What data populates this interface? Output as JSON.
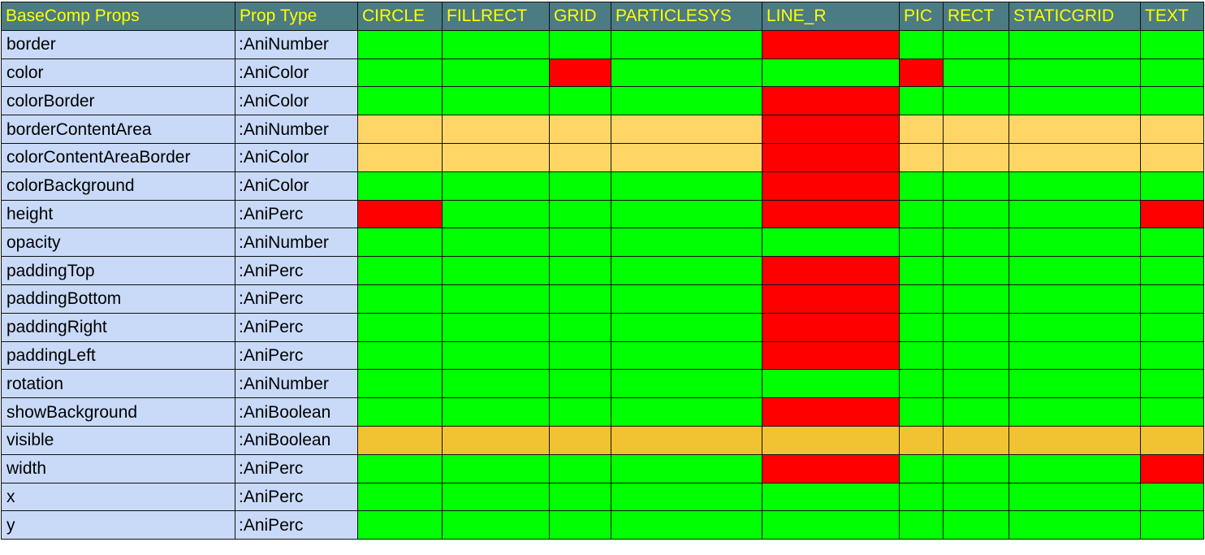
{
  "colors": {
    "header_bg": "#4b7b83",
    "header_text": "#ffff00",
    "prop_bg": "#c9daf8",
    "ok": "#00ff00",
    "fail": "#ff0000",
    "partial_light": "#ffd666",
    "partial_dark": "#f1c232"
  },
  "legend": {
    "G": "green",
    "R": "red",
    "P": "pale",
    "A": "amber"
  },
  "headers": [
    "BaseComp Props",
    "Prop Type",
    "CIRCLE",
    "FILLRECT",
    "GRID",
    "PARTICLESYS",
    "LINE_R",
    "PIC",
    "RECT",
    "STATICGRID",
    "TEXT"
  ],
  "rows": [
    {
      "prop": "border",
      "type": ":AniNumber",
      "status": [
        "G",
        "G",
        "G",
        "G",
        "R",
        "G",
        "G",
        "G",
        "G"
      ]
    },
    {
      "prop": "color",
      "type": ":AniColor",
      "status": [
        "G",
        "G",
        "R",
        "G",
        "G",
        "R",
        "G",
        "G",
        "G"
      ]
    },
    {
      "prop": "colorBorder",
      "type": ":AniColor",
      "status": [
        "G",
        "G",
        "G",
        "G",
        "R",
        "G",
        "G",
        "G",
        "G"
      ]
    },
    {
      "prop": "borderContentArea",
      "type": ":AniNumber",
      "status": [
        "P",
        "P",
        "P",
        "P",
        "R",
        "P",
        "P",
        "P",
        "P"
      ]
    },
    {
      "prop": "colorContentAreaBorder",
      "type": ":AniColor",
      "status": [
        "P",
        "P",
        "P",
        "P",
        "R",
        "P",
        "P",
        "P",
        "P"
      ]
    },
    {
      "prop": "colorBackground",
      "type": ":AniColor",
      "status": [
        "G",
        "G",
        "G",
        "G",
        "R",
        "G",
        "G",
        "G",
        "G"
      ]
    },
    {
      "prop": "height",
      "type": ":AniPerc",
      "status": [
        "R",
        "G",
        "G",
        "G",
        "R",
        "G",
        "G",
        "G",
        "R"
      ]
    },
    {
      "prop": "opacity",
      "type": ":AniNumber",
      "status": [
        "G",
        "G",
        "G",
        "G",
        "G",
        "G",
        "G",
        "G",
        "G"
      ]
    },
    {
      "prop": "paddingTop",
      "type": ":AniPerc",
      "status": [
        "G",
        "G",
        "G",
        "G",
        "R",
        "G",
        "G",
        "G",
        "G"
      ]
    },
    {
      "prop": "paddingBottom",
      "type": ":AniPerc",
      "status": [
        "G",
        "G",
        "G",
        "G",
        "R",
        "G",
        "G",
        "G",
        "G"
      ]
    },
    {
      "prop": "paddingRight",
      "type": ":AniPerc",
      "status": [
        "G",
        "G",
        "G",
        "G",
        "R",
        "G",
        "G",
        "G",
        "G"
      ]
    },
    {
      "prop": "paddingLeft",
      "type": ":AniPerc",
      "status": [
        "G",
        "G",
        "G",
        "G",
        "R",
        "G",
        "G",
        "G",
        "G"
      ]
    },
    {
      "prop": "rotation",
      "type": ":AniNumber",
      "status": [
        "G",
        "G",
        "G",
        "G",
        "G",
        "G",
        "G",
        "G",
        "G"
      ]
    },
    {
      "prop": "showBackground",
      "type": ":AniBoolean",
      "status": [
        "G",
        "G",
        "G",
        "G",
        "R",
        "G",
        "G",
        "G",
        "G"
      ]
    },
    {
      "prop": "visible",
      "type": ":AniBoolean",
      "status": [
        "A",
        "A",
        "A",
        "A",
        "A",
        "A",
        "A",
        "A",
        "A"
      ]
    },
    {
      "prop": "width",
      "type": ":AniPerc",
      "status": [
        "G",
        "G",
        "G",
        "G",
        "R",
        "G",
        "G",
        "G",
        "R"
      ]
    },
    {
      "prop": "x",
      "type": ":AniPerc",
      "status": [
        "G",
        "G",
        "G",
        "G",
        "G",
        "G",
        "G",
        "G",
        "G"
      ]
    },
    {
      "prop": "y",
      "type": ":AniPerc",
      "status": [
        "G",
        "G",
        "G",
        "G",
        "G",
        "G",
        "G",
        "G",
        "G"
      ]
    }
  ]
}
